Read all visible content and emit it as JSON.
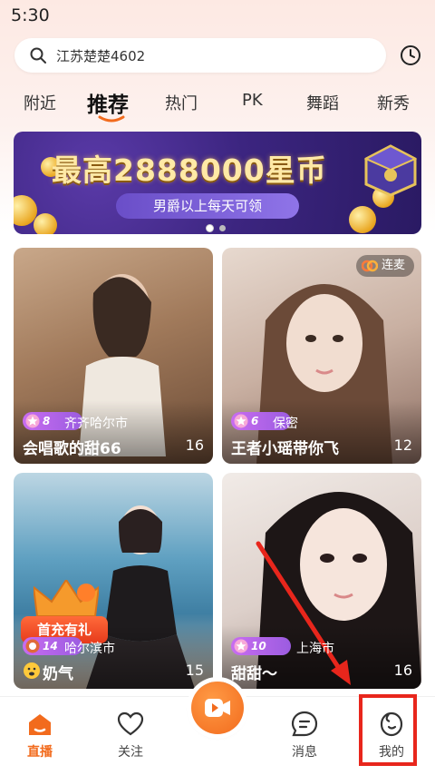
{
  "status_bar": {
    "time": "5:30"
  },
  "search": {
    "text": "江苏楚楚4602"
  },
  "tabs": [
    {
      "label": "附近"
    },
    {
      "label": "推荐"
    },
    {
      "label": "热门"
    },
    {
      "label": "PK"
    },
    {
      "label": "舞蹈"
    },
    {
      "label": "新秀"
    }
  ],
  "active_tab": "推荐",
  "banner": {
    "title": "最高2888000星币",
    "subtitle": "男爵以上每天可领",
    "page_count": 2,
    "current_page": 1
  },
  "cards": [
    {
      "level": "8",
      "city": "齐齐哈尔市",
      "name": "会唱歌的甜66",
      "count": "16"
    },
    {
      "level": "6",
      "city": "保密",
      "name": "王者小瑶带你飞",
      "count": "12",
      "tag": "连麦"
    },
    {
      "level": "14",
      "city": "哈尔滨市",
      "name": "奶气",
      "count": "15",
      "promo": "首充有礼"
    },
    {
      "level": "10",
      "city": "上海市",
      "name": "甜甜〜",
      "count": "16"
    }
  ],
  "nav": [
    {
      "label": "直播",
      "icon": "home-icon",
      "active": true
    },
    {
      "label": "关注",
      "icon": "heart-icon",
      "active": false
    },
    {
      "label": "",
      "icon": "live-camera-icon",
      "active": false
    },
    {
      "label": "消息",
      "icon": "message-icon",
      "active": false
    },
    {
      "label": "我的",
      "icon": "profile-icon",
      "active": false
    }
  ],
  "colors": {
    "accent": "#f26b1d",
    "badge": "#b565e8",
    "highlight": "#e8261c"
  }
}
